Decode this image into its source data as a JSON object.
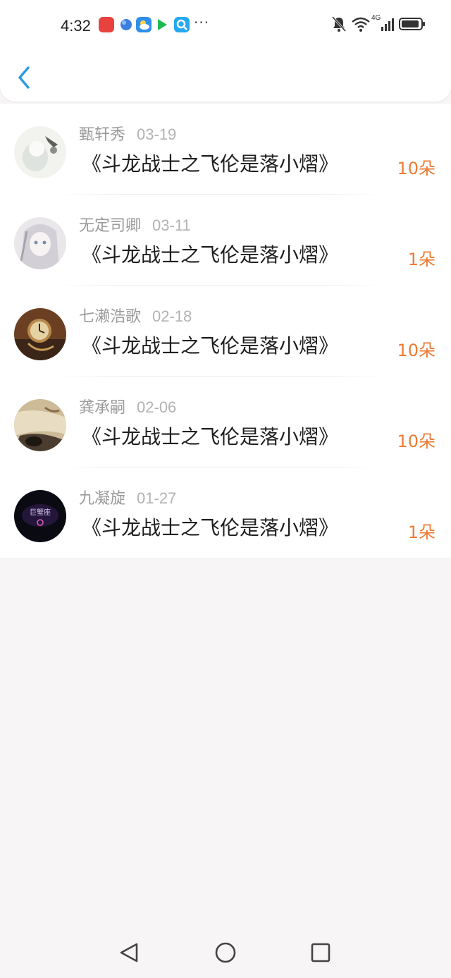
{
  "status_bar": {
    "time": "4:32",
    "notification_icons": [
      "reader-app-icon",
      "browser-app-icon",
      "weather-app-icon",
      "video-app-icon",
      "search-app-icon"
    ],
    "overflow": "···",
    "network": "4G"
  },
  "header": {
    "back_icon": "chevron-left-icon"
  },
  "gifts": [
    {
      "user": "甄轩秀",
      "date": "03-19",
      "title": "《斗龙战士之飞伦是落小熠》",
      "count": "10朵",
      "avatar_colors": [
        "#f2f2ef",
        "#8a8f8c"
      ]
    },
    {
      "user": "无定司卿",
      "date": "03-11",
      "title": "《斗龙战士之飞伦是落小熠》",
      "count": "1朵",
      "avatar_colors": [
        "#e9e7ea",
        "#a7a3ab"
      ]
    },
    {
      "user": "七濑浩歌",
      "date": "02-18",
      "title": "《斗龙战士之飞伦是落小熠》",
      "count": "10朵",
      "avatar_colors": [
        "#a4612f",
        "#3a2518"
      ]
    },
    {
      "user": "龚承嗣",
      "date": "02-06",
      "title": "《斗龙战士之飞伦是落小熠》",
      "count": "10朵",
      "avatar_colors": [
        "#d9caa8",
        "#4b3c30"
      ]
    },
    {
      "user": "九凝旋",
      "date": "01-27",
      "title": "《斗龙战士之飞伦是落小熠》",
      "count": "1朵",
      "avatar_colors": [
        "#0a0a12",
        "#3a1f5e"
      ],
      "avatar_text": "巨蟹座"
    }
  ],
  "colors": {
    "accent_blue": "#2b9ae0",
    "count_orange": "#ef7b34",
    "page_bg": "#f7f5f6"
  },
  "nav": [
    "back-triangle-icon",
    "home-circle-icon",
    "recents-square-icon"
  ]
}
